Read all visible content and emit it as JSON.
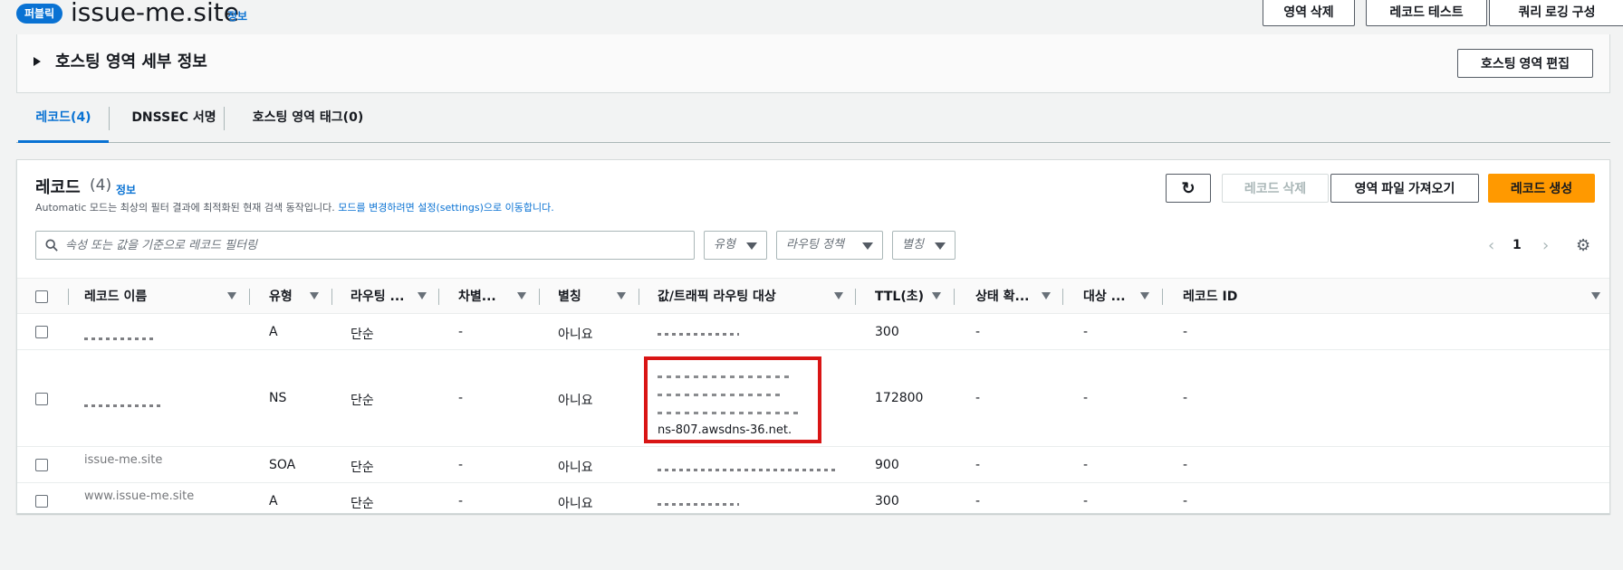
{
  "header": {
    "badge": "퍼블릭",
    "zone_name": "issue-me.site",
    "info": "정보",
    "buttons": {
      "delete_zone": "영역 삭제",
      "test_record": "레코드 테스트",
      "query_logging": "쿼리 로깅 구성"
    }
  },
  "details": {
    "title": "호스팅 영역 세부 정보",
    "edit_button": "호스팅 영역 편집"
  },
  "tabs": [
    {
      "label": "레코드(4)",
      "active": true
    },
    {
      "label": "DNSSEC 서명",
      "active": false
    },
    {
      "label": "호스팅 영역 태그(0)",
      "active": false
    }
  ],
  "records": {
    "title": "레코드",
    "count": "(4)",
    "info": "정보",
    "description": "Automatic 모드는 최상의 필터 결과에 최적화된 현재 검색 동작입니다. ",
    "description_link": "모드를 변경하려면 설정(settings)으로 이동합니다.",
    "buttons": {
      "refresh": "↻",
      "delete": "레코드 삭제",
      "import": "영역 파일 가져오기",
      "create": "레코드 생성"
    },
    "search_placeholder": "속성 또는 값을 기준으로 레코드 필터링",
    "filters": [
      "유형",
      "라우팅 정책",
      "별칭"
    ],
    "pager": {
      "prev": "‹",
      "page": "1",
      "next": "›"
    },
    "columns": [
      "레코드 이름",
      "유형",
      "라우팅 ...",
      "차별...",
      "별칭",
      "값/트래픽 라우팅 대상",
      "TTL(초)",
      "상태 확...",
      "대상 ...",
      "레코드 ID"
    ],
    "rows": [
      {
        "name": "",
        "type": "A",
        "routing": "단순",
        "diff": "-",
        "alias": "아니요",
        "value": "",
        "ttl": "300",
        "health": "-",
        "target": "-",
        "record_id": "-"
      },
      {
        "name": "",
        "type": "NS",
        "routing": "단순",
        "diff": "-",
        "alias": "아니요",
        "value": "ns-807.awsdns-36.net.",
        "ttl": "172800",
        "health": "-",
        "target": "-",
        "record_id": "-"
      },
      {
        "name": "issue-me.site",
        "type": "SOA",
        "routing": "단순",
        "diff": "-",
        "alias": "아니요",
        "value": "",
        "ttl": "900",
        "health": "-",
        "target": "-",
        "record_id": "-"
      },
      {
        "name": "www.issue-me.site",
        "type": "A",
        "routing": "단순",
        "diff": "-",
        "alias": "아니요",
        "value": "",
        "ttl": "300",
        "health": "-",
        "target": "-",
        "record_id": "-"
      }
    ]
  },
  "colors": {
    "accent": "#0972d3",
    "primary_button": "#ff9900",
    "highlight": "#d91515"
  }
}
